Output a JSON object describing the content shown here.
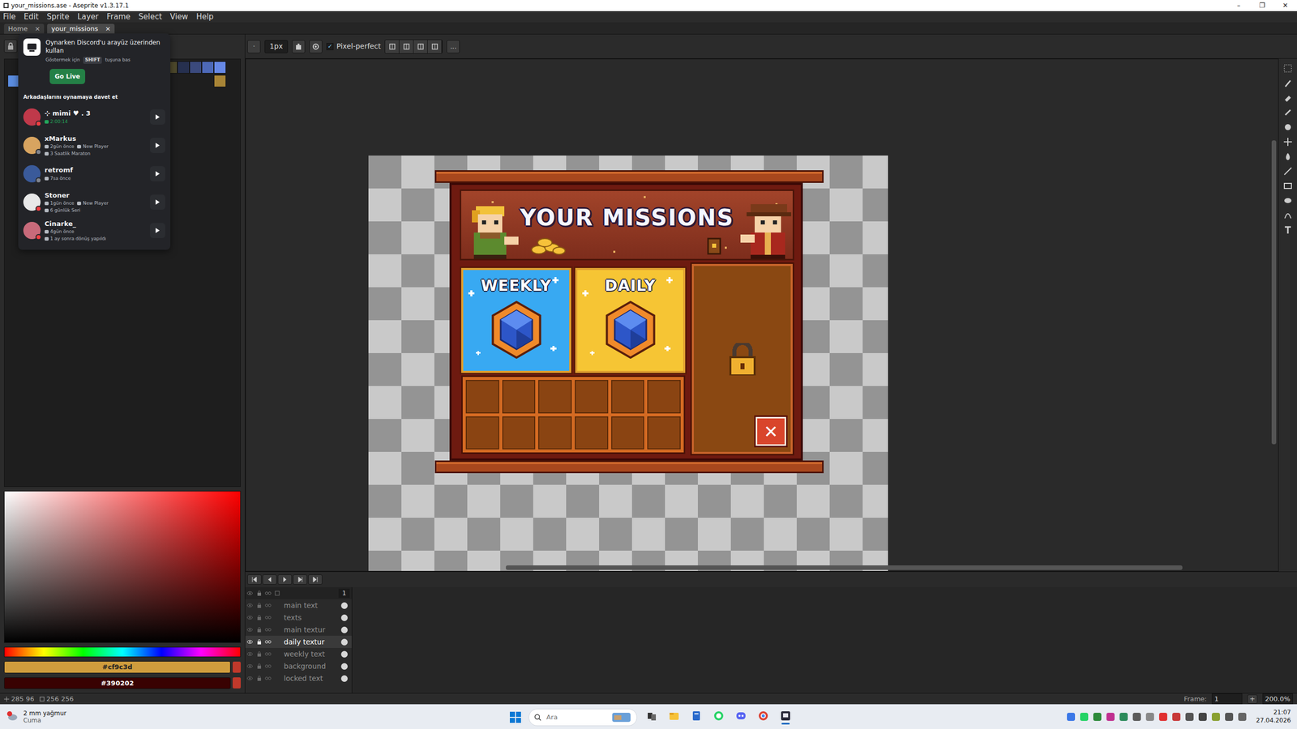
{
  "window": {
    "title": "your_missions.ase - Aseprite v1.3.17.1",
    "controls": [
      "–",
      "❐",
      "✕"
    ]
  },
  "menu": [
    "File",
    "Edit",
    "Sprite",
    "Layer",
    "Frame",
    "Select",
    "View",
    "Help"
  ],
  "tabs": [
    {
      "label": "Home",
      "close": "×",
      "selected": false
    },
    {
      "label": "your_missions",
      "close": "×",
      "selected": true
    }
  ],
  "context_bar": {
    "brush_type": "·",
    "brush_size": "1px",
    "pixel_perfect": {
      "label": "Pixel-perfect",
      "checked": true
    },
    "more": "..."
  },
  "palette": {
    "rows": [
      [
        {
          "color": "#4f4a2c"
        },
        {
          "color": "#26304f"
        },
        {
          "color": "#3b4a7d"
        },
        {
          "color": "#4d69b8"
        },
        {
          "color": "#6688e6"
        }
      ],
      [
        {
          "color": "#5b8de0"
        },
        {
          "color": "#a88436"
        }
      ]
    ]
  },
  "colors": {
    "foreground": "#cf9c3d",
    "background": "#390202"
  },
  "sprite": {
    "title": "YOUR MISSIONS",
    "cards": [
      {
        "label": "WEEKLY",
        "color": "#38a9f2"
      },
      {
        "label": "DAILY",
        "color": "#f6c534"
      }
    ],
    "locked": true,
    "close": "✕"
  },
  "timeline": {
    "frame_header": "1",
    "layers": [
      {
        "name": "main text",
        "visible": true,
        "selected": false
      },
      {
        "name": "texts",
        "visible": true,
        "selected": false
      },
      {
        "name": "main textur",
        "visible": true,
        "selected": false
      },
      {
        "name": "daily textur",
        "visible": true,
        "selected": true
      },
      {
        "name": "weekly text",
        "visible": true,
        "selected": false
      },
      {
        "name": "background",
        "visible": true,
        "selected": false
      },
      {
        "name": "locked text",
        "visible": true,
        "selected": false
      }
    ]
  },
  "status_bar": {
    "position": "285 96",
    "size": "256 256",
    "frame_label": "Frame:",
    "frame": "1",
    "add": "+",
    "zoom": "200.0%"
  },
  "overlay": {
    "heading": "Oynarken Discord'u arayüz üzerinden kullan",
    "hint": [
      "Göstermek için",
      "SHIFT",
      "tuşuna bas"
    ],
    "go_live": "Go Live",
    "section": "Arkadaşlarını oynamaya davet et",
    "friends": [
      {
        "name": "⊹ mimi ♥ . 3",
        "color": "#c0394a",
        "status_color": "#f23f43",
        "lines": [
          [
            "2:00:14"
          ]
        ],
        "playing": true
      },
      {
        "name": "xMarkus",
        "color": "#d8a460",
        "status_color": "#80848e",
        "lines": [
          [
            "2gün önce",
            "New Player"
          ],
          [
            "3 Saatlik Maraton"
          ]
        ],
        "playing": false
      },
      {
        "name": "retromf",
        "color": "#3a5a9a",
        "status_color": "#80848e",
        "lines": [
          [
            "7sa önce"
          ]
        ],
        "playing": false
      },
      {
        "name": "Stoner",
        "color": "#e8e8e8",
        "status_color": "#f23f43",
        "lines": [
          [
            "1gün önce",
            "New Player"
          ],
          [
            "6 günlük Seri"
          ]
        ],
        "playing": false
      },
      {
        "name": "Cinarke_",
        "color": "#c86a7a",
        "status_color": "#f23f43",
        "lines": [
          [
            "4gün önce"
          ],
          [
            "1 ay sonra dönüş yapıldı"
          ]
        ],
        "playing": false
      }
    ]
  },
  "taskbar": {
    "weather": {
      "text": "2 mm yağmur",
      "day": "Cuma"
    },
    "search": {
      "placeholder": "Ara"
    },
    "apps": [
      {
        "selected": false
      },
      {
        "selected": false
      },
      {
        "selected": false
      },
      {
        "selected": false
      },
      {
        "selected": false
      },
      {
        "selected": false
      },
      {
        "selected": true
      }
    ],
    "time": "21:07",
    "date": "27.04.2026"
  }
}
